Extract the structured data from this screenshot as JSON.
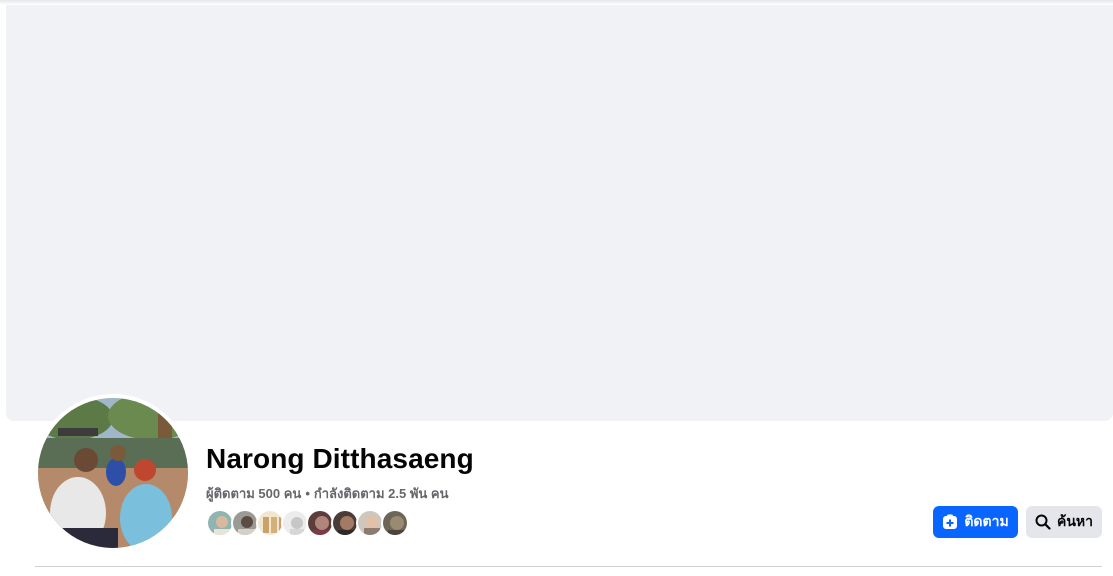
{
  "profile": {
    "name": "Narong Ditthasaeng",
    "followers": "ผู้ติดตาม 500 คน",
    "separator": "•",
    "following": "กำลังติดตาม 2.5 พัน คน"
  },
  "actions": {
    "follow_label": "ติดตาม",
    "search_label": "ค้นหา"
  },
  "mutual_friends": [
    {
      "name": "mutual-friend-1"
    },
    {
      "name": "mutual-friend-2"
    },
    {
      "name": "mutual-friend-3"
    },
    {
      "name": "mutual-friend-4"
    },
    {
      "name": "mutual-friend-5"
    },
    {
      "name": "mutual-friend-6"
    },
    {
      "name": "mutual-friend-7"
    },
    {
      "name": "mutual-friend-8"
    }
  ],
  "colors": {
    "primary_button": "#0866ff",
    "secondary_button": "#e4e6eb",
    "cover_placeholder": "#f0f2f5",
    "secondary_text": "#65676b"
  }
}
